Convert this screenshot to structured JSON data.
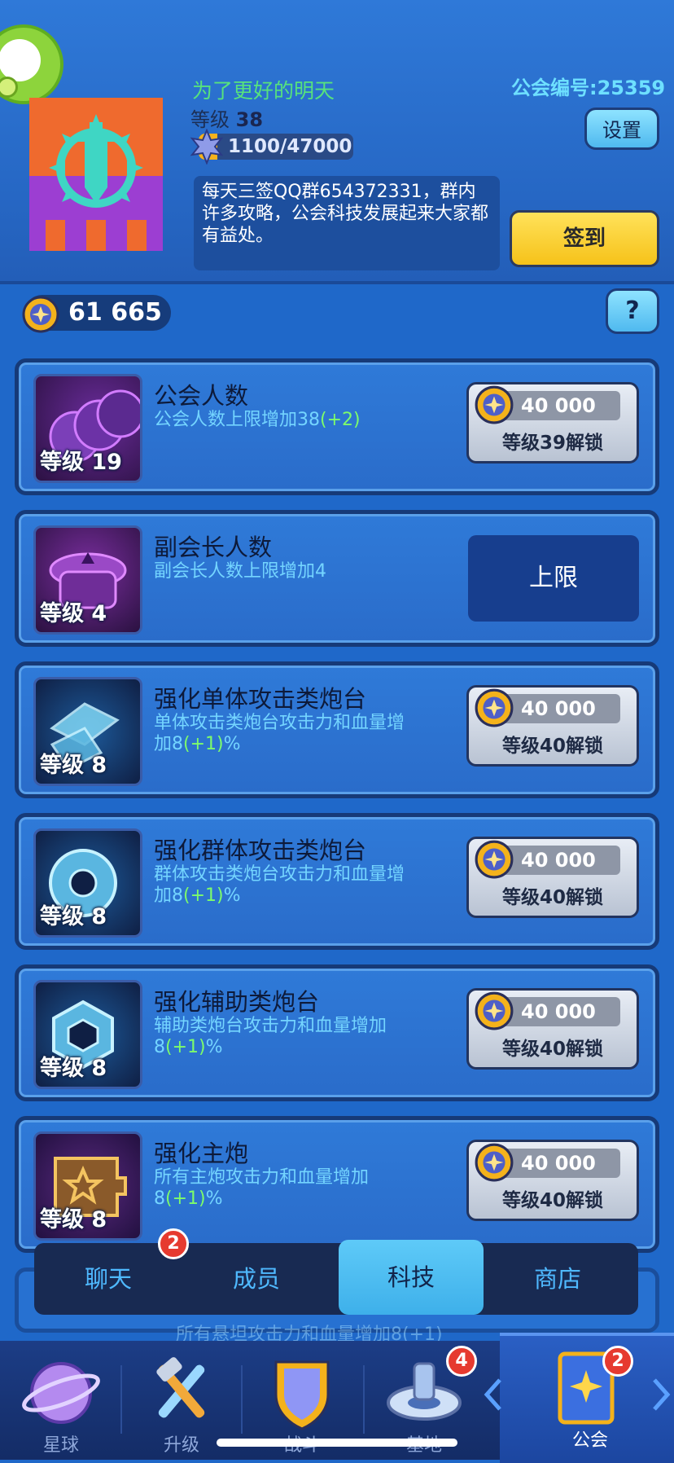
{
  "colors": {
    "accent": "#4fb9ef",
    "signin": "#f6c21a",
    "bg": "#1f68c9",
    "green_text": "#57e27d",
    "desc": "#74d5ff"
  },
  "guild": {
    "name": "为了更好的明天",
    "level_label": "等级",
    "level_value": "38",
    "xp_text": "1100/47000",
    "xp_progress": 0.023,
    "id_label": "公会编号:25359",
    "settings_label": "设置",
    "announcement": "每天三签QQ群654372331，群内许多攻略，公会科技发展起来大家都有益处。",
    "signin_label": "签到",
    "emblem_icon": "sword-sun-castle-emblem-icon"
  },
  "currency": {
    "value": "61 665",
    "icon": "guild-coin-icon",
    "help_label": "?"
  },
  "techs": [
    {
      "title": "公会人数",
      "desc_main": "公会人数上限增加38",
      "desc_bonus": "(+2)",
      "desc_tail": "",
      "level": "等级 19",
      "cost": "40 000",
      "requirement": "等级39解锁",
      "icon": "members-icon"
    },
    {
      "title": "副会长人数",
      "desc_main": "副会长人数上限增加4",
      "desc_bonus": "",
      "desc_tail": "",
      "level": "等级 4",
      "max_label": "上限",
      "icon": "officer-cap-icon"
    },
    {
      "title": "强化单体攻击类炮台",
      "desc_main": "单体攻击类炮台攻击力和血量增加8",
      "desc_bonus": "(+1)",
      "desc_tail": "%",
      "level": "等级 8",
      "cost": "40 000",
      "requirement": "等级40解锁",
      "icon": "single-target-turret-icon"
    },
    {
      "title": "强化群体攻击类炮台",
      "desc_main": "群体攻击类炮台攻击力和血量增加8",
      "desc_bonus": "(+1)",
      "desc_tail": "%",
      "level": "等级 8",
      "cost": "40 000",
      "requirement": "等级40解锁",
      "icon": "aoe-turret-icon"
    },
    {
      "title": "强化辅助类炮台",
      "desc_main": "辅助类炮台攻击力和血量增加8",
      "desc_bonus": "(+1)",
      "desc_tail": "%",
      "level": "等级 8",
      "cost": "40 000",
      "requirement": "等级40解锁",
      "icon": "support-turret-icon"
    },
    {
      "title": "强化主炮",
      "desc_main": "所有主炮攻击力和血量增加8",
      "desc_bonus": "(+1)",
      "desc_tail": "%",
      "level": "等级 8",
      "cost": "40 000",
      "requirement": "等级40解锁",
      "icon": "main-cannon-icon"
    }
  ],
  "ghost_row_text": "所有悬坦攻击力和血量增加8(+1)",
  "tabs": [
    {
      "label": "聊天",
      "badge": "2"
    },
    {
      "label": "成员",
      "badge": ""
    },
    {
      "label": "科技",
      "badge": "",
      "active": true
    },
    {
      "label": "商店",
      "badge": ""
    }
  ],
  "nav": [
    {
      "label": "星球",
      "icon": "planet-icon",
      "badge": ""
    },
    {
      "label": "升级",
      "icon": "wrench-hammer-icon",
      "badge": ""
    },
    {
      "label": "战斗",
      "icon": "shield-icon",
      "badge": ""
    },
    {
      "label": "基地",
      "icon": "base-station-icon",
      "badge": "4"
    },
    {
      "label": "公会",
      "icon": "guild-banner-icon",
      "badge": "2"
    }
  ]
}
